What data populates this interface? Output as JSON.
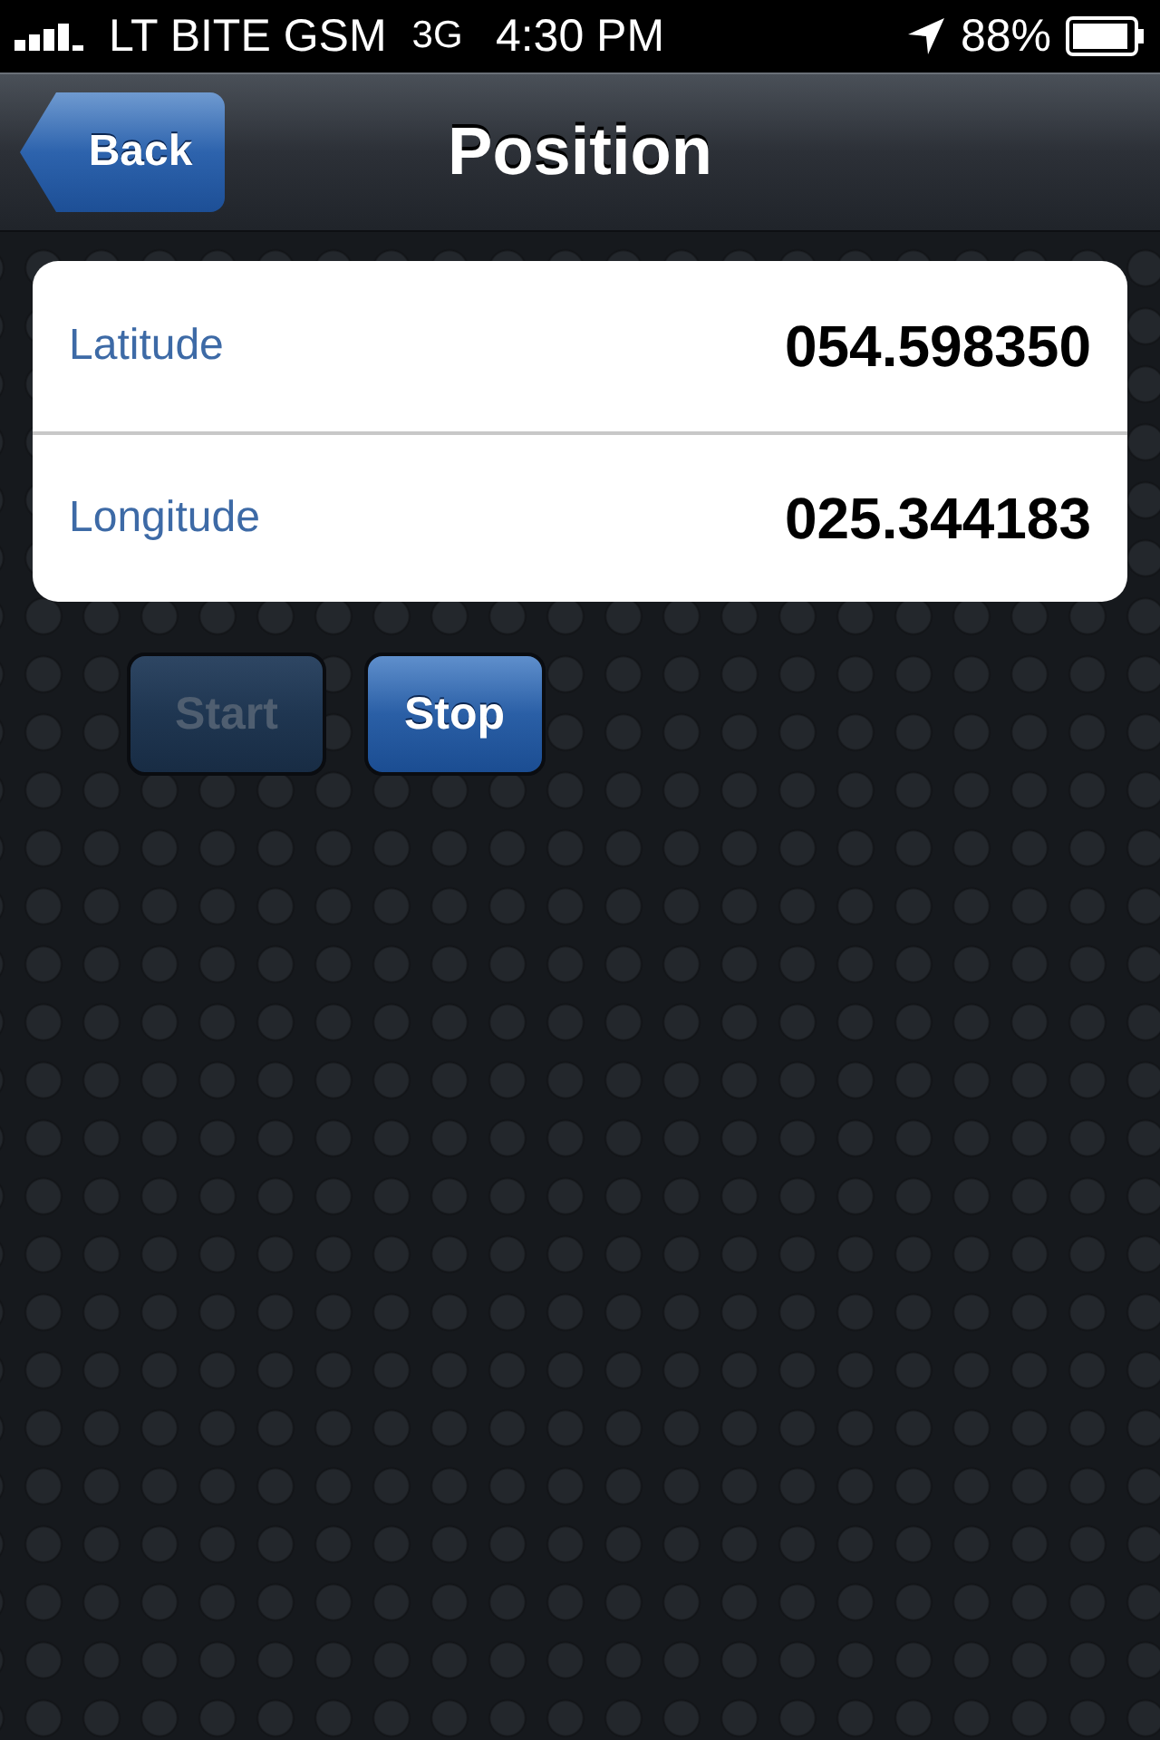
{
  "status_bar": {
    "carrier": "LT BITE GSM",
    "network": "3G",
    "time": "4:30 PM",
    "battery": "88%"
  },
  "nav_bar": {
    "back": "Back",
    "title": "Position"
  },
  "fields": [
    {
      "label": "Latitude",
      "value": "054.598350"
    },
    {
      "label": "Longitude",
      "value": "025.344183"
    }
  ],
  "buttons": [
    {
      "label": "Start",
      "disabled": true
    },
    {
      "label": "Stop",
      "disabled": false
    }
  ]
}
